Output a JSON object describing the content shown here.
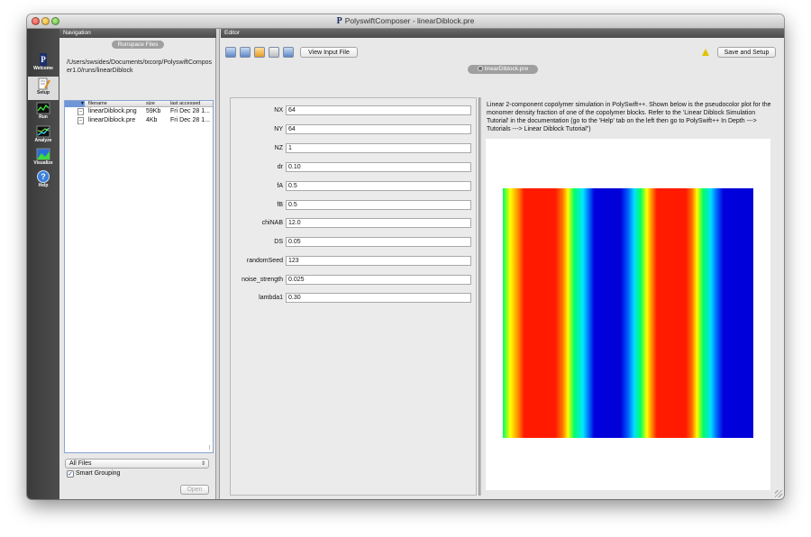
{
  "window": {
    "title": "PolyswiftComposer - linearDiblock.pre"
  },
  "sidebar": {
    "items": [
      {
        "label": "Welcome",
        "icon": "welcome-icon"
      },
      {
        "label": "Setup",
        "icon": "setup-icon"
      },
      {
        "label": "Run",
        "icon": "run-icon"
      },
      {
        "label": "Analyze",
        "icon": "analyze-icon"
      },
      {
        "label": "Visualize",
        "icon": "visualize-icon"
      },
      {
        "label": "Help",
        "icon": "help-icon"
      }
    ],
    "active": "Setup"
  },
  "navigation": {
    "header": "Navigation",
    "section_title": "Runspace Files",
    "path": "/Users/swsides/Documents/txcorp/PolyswiftComposer1.0/runs/linearDiblock",
    "columns": [
      "filename",
      "size",
      "last accessed"
    ],
    "files": [
      {
        "filename": "linearDiblock.png",
        "size": "59Kb",
        "last_accessed": "Fri Dec 28 1..."
      },
      {
        "filename": "linearDiblock.pre",
        "size": "4Kb",
        "last_accessed": "Fri Dec 28 1..."
      }
    ],
    "filter": "All Files",
    "smart_grouping_label": "Smart Grouping",
    "smart_grouping_checked": true,
    "open_label": "Open"
  },
  "editor": {
    "header": "Editor",
    "view_input_label": "View Input File",
    "save_setup_label": "Save and Setup",
    "tab_label": "linearDiblock.pre",
    "params": [
      {
        "name": "NX",
        "value": "64"
      },
      {
        "name": "NY",
        "value": "64"
      },
      {
        "name": "NZ",
        "value": "1"
      },
      {
        "name": "dr",
        "value": "0.10"
      },
      {
        "name": "fA",
        "value": "0.5"
      },
      {
        "name": "fB",
        "value": "0.5"
      },
      {
        "name": "chiNAB",
        "value": "12.0"
      },
      {
        "name": "DS",
        "value": "0.05"
      },
      {
        "name": "randomSeed",
        "value": "123"
      },
      {
        "name": "noise_strength",
        "value": "0.025"
      },
      {
        "name": "lambda1",
        "value": "0.30"
      }
    ],
    "description": "Linear 2-component copolymer simulation in PolySwift++. Shown below is the pseudocolor plot for the monomer density fraction of one of the copolymer blocks. Refer to the 'Linear Diblock Simulation Tutorial' in the documentation (go to the 'Help' tab on the left then go to PolySwift++ In Depth ---> Tutorials ---> Linear Diblock Tutorial\")"
  },
  "colors": {
    "accent": "#6f96d6",
    "sidebar_bg": "#444444",
    "header_bg": "#555555",
    "warning": "#e2c200"
  }
}
